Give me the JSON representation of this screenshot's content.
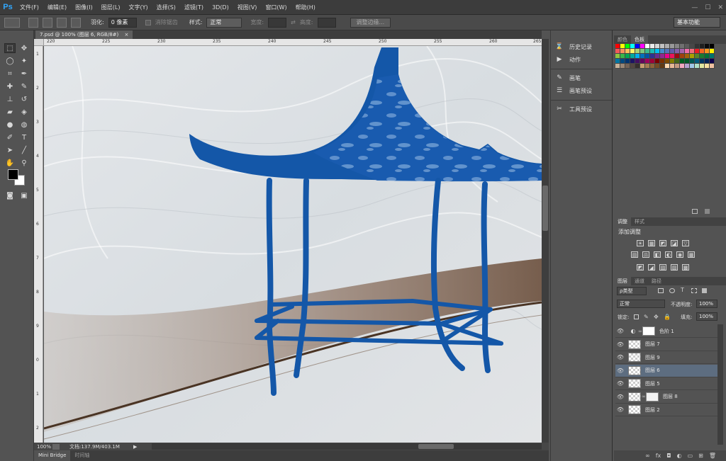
{
  "app": {
    "logo": "Ps"
  },
  "menu": [
    "文件(F)",
    "编辑(E)",
    "图像(I)",
    "图层(L)",
    "文字(Y)",
    "选择(S)",
    "滤镜(T)",
    "3D(D)",
    "视图(V)",
    "窗口(W)",
    "帮助(H)"
  ],
  "window_controls": [
    "—",
    "☐",
    "✕"
  ],
  "options": {
    "feather_label": "羽化:",
    "feather_value": "0 像素",
    "antialias_label": "消除锯齿",
    "style_label": "样式:",
    "style_value": "正常",
    "width_label": "宽度:",
    "height_label": "高度:",
    "refine_button": "调整边缘...",
    "workspace": "基本功能"
  },
  "document": {
    "tab_title": "7.psd @ 100% (图层 6, RGB/8#)",
    "tab_close": "×",
    "zoom": "100%",
    "doc_info": "文档:137.9M/403.1M",
    "arrow": "▶",
    "ruler_ticks": [
      "220",
      "225",
      "230",
      "235",
      "240",
      "245",
      "250",
      "255",
      "260",
      "265"
    ],
    "ruler_left_ticks": [
      "1",
      "2",
      "3",
      "4",
      "5",
      "6",
      "7",
      "8",
      "9",
      "0",
      "1",
      "2"
    ]
  },
  "bottom_tabs": [
    "Mini Bridge",
    "时间轴"
  ],
  "mid_panel": {
    "items": [
      {
        "icon": "history-icon",
        "glyph": "⌛",
        "label": "历史记录"
      },
      {
        "icon": "actions-icon",
        "glyph": "▶",
        "label": "动作"
      },
      {
        "icon": "brush-icon",
        "glyph": "✎",
        "label": "画笔"
      },
      {
        "icon": "brush-presets-icon",
        "glyph": "☰",
        "label": "画笔预设"
      },
      {
        "icon": "tool-presets-icon",
        "glyph": "✂",
        "label": "工具预设"
      }
    ]
  },
  "swatches": {
    "tabs": [
      "颜色",
      "色板"
    ],
    "colors": [
      "#ff0000",
      "#ffff00",
      "#00ff00",
      "#00ffff",
      "#0000ff",
      "#ff00ff",
      "#ffffff",
      "#ebebeb",
      "#d6d6d6",
      "#c2c2c2",
      "#adadad",
      "#999999",
      "#858585",
      "#707070",
      "#5c5c5c",
      "#474747",
      "#333333",
      "#1f1f1f",
      "#0a0a0a",
      "#000000",
      "#f15a5a",
      "#f6915e",
      "#fcbd5b",
      "#fff467",
      "#acd373",
      "#7bc77f",
      "#3bb98b",
      "#1cbbb4",
      "#00bff3",
      "#438ccb",
      "#5574b9",
      "#605ca8",
      "#855fa8",
      "#a763a9",
      "#f06ea9",
      "#f26d7d",
      "#ed1c24",
      "#f26522",
      "#f7941d",
      "#fff200",
      "#8dc63f",
      "#39b54a",
      "#00a651",
      "#00a99d",
      "#00aeef",
      "#0072bc",
      "#0054a6",
      "#2e3192",
      "#662d91",
      "#92278f",
      "#ec008c",
      "#ed145b",
      "#9e0b0f",
      "#a0410d",
      "#a36209",
      "#aba000",
      "#598527",
      "#197b30",
      "#007236",
      "#00746b",
      "#0076a3",
      "#004a80",
      "#003471",
      "#1b1464",
      "#440e62",
      "#630460",
      "#9e005d",
      "#9e0039",
      "#790000",
      "#7b2e00",
      "#7d4900",
      "#827b00",
      "#406618",
      "#005e20",
      "#005826",
      "#005952",
      "#005b7f",
      "#003663",
      "#002157",
      "#0d004c",
      "#c7b299",
      "#998675",
      "#736357",
      "#534741",
      "#37302d",
      "#c69c6e",
      "#a67c52",
      "#8c6239",
      "#754c24",
      "#603913",
      "#ffd8b0",
      "#e8b896",
      "#c59a80",
      "#f3a8c0",
      "#b6a0d0",
      "#a0c8e8",
      "#b0e0c8",
      "#e0e8a0",
      "#f8e0a0",
      "#f0c0a0"
    ]
  },
  "adjustments": {
    "tabs": [
      "调整",
      "样式"
    ],
    "title": "添加调整",
    "row1": [
      "☀",
      "▦",
      "◩",
      "◪",
      "▽"
    ],
    "row2": [
      "▤",
      "⚖",
      "◧",
      "◐",
      "◉",
      "▦"
    ],
    "row3": [
      "◩",
      "◢",
      "▧",
      "▨",
      "▩"
    ]
  },
  "layers": {
    "tabs": [
      "图层",
      "通道",
      "路径"
    ],
    "filter": "ρ类型",
    "blend_mode": "正常",
    "opacity_label": "不透明度:",
    "opacity_value": "100%",
    "lock_label": "锁定:",
    "fill_label": "填充:",
    "fill_value": "100%",
    "items": [
      {
        "name": "色阶 1",
        "type": "adjustment",
        "selected": false
      },
      {
        "name": "图层 7",
        "type": "normal",
        "selected": false
      },
      {
        "name": "图层 9",
        "type": "normal",
        "selected": false
      },
      {
        "name": "图层 6",
        "type": "normal",
        "selected": true
      },
      {
        "name": "图层 5",
        "type": "normal",
        "selected": false
      },
      {
        "name": "图层 8",
        "type": "masked",
        "selected": false
      },
      {
        "name": "图层 2",
        "type": "normal",
        "selected": false
      }
    ],
    "footer_icons": [
      "∞",
      "fx",
      "◘",
      "◐",
      "▭",
      "⊞",
      "🗑"
    ]
  },
  "colors": {
    "pavilion_blue": "#1457a8",
    "ps_blue": "#31a8ff",
    "selected_layer": "#5d6d80"
  }
}
